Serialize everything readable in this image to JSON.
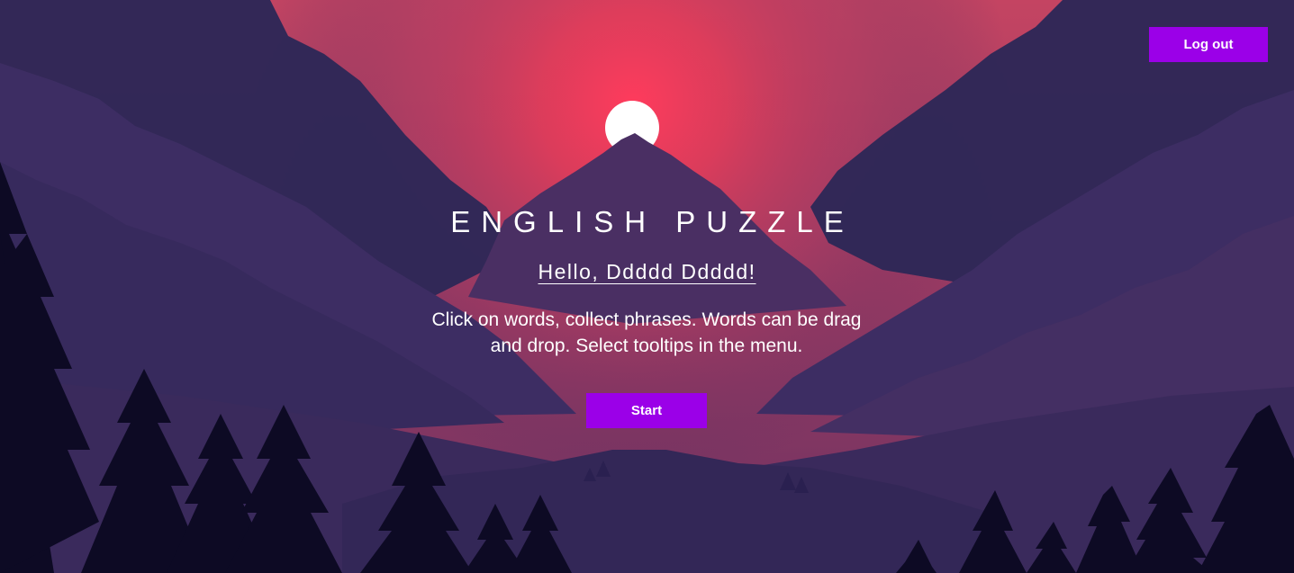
{
  "header": {
    "logout_label": "Log out"
  },
  "main": {
    "title": "ENGLISH PUZZLE",
    "greeting": "Hello, Ddddd Ddddd!",
    "description": "Click on words, collect phrases. Words can be drag and drop. Select tooltips in the menu.",
    "start_label": "Start"
  },
  "theme": {
    "accent": "#9b00e8",
    "sky_glow": "#ff3b5c",
    "text": "#ffffff"
  },
  "background": {
    "scene": "mountain-sunset-illustration"
  }
}
